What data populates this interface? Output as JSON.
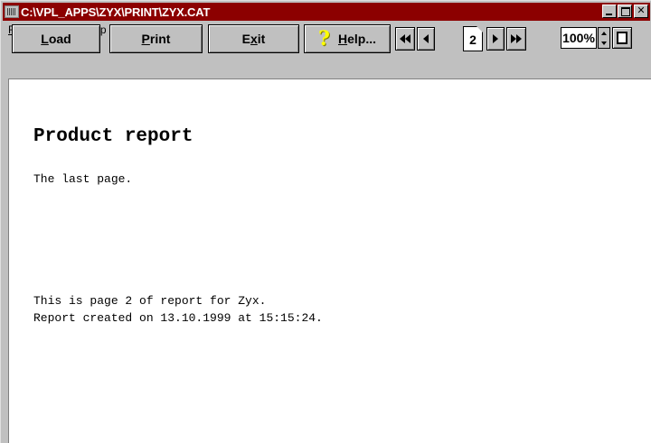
{
  "window": {
    "title": "C:\\VPL_APPS\\ZYX\\PRINT\\ZYX.CAT",
    "title_bar_color": "#8c0000",
    "controls": {
      "minimize": "minimize-icon",
      "maximize": "maximize-icon",
      "close_label": "✕"
    }
  },
  "menu": {
    "items": [
      {
        "first": "R",
        "rest": "eport"
      },
      {
        "first": "V",
        "rest": "iew"
      },
      {
        "first": "H",
        "rest": "elp"
      }
    ]
  },
  "toolbar": {
    "load": {
      "first": "L",
      "rest": "oad"
    },
    "print": {
      "first": "P",
      "rest": "rint"
    },
    "exit": {
      "pre": "E",
      "mid": "x",
      "rest": "it"
    },
    "help": {
      "icon": "question-icon",
      "first": "H",
      "rest": "elp..."
    },
    "page_number": "2",
    "zoom": "100%"
  },
  "document": {
    "heading": "Product report",
    "line1": "The last page.",
    "line2": "This is page 2 of report for Zyx.",
    "line3": "Report created on 13.10.1999 at 15:15:24."
  }
}
